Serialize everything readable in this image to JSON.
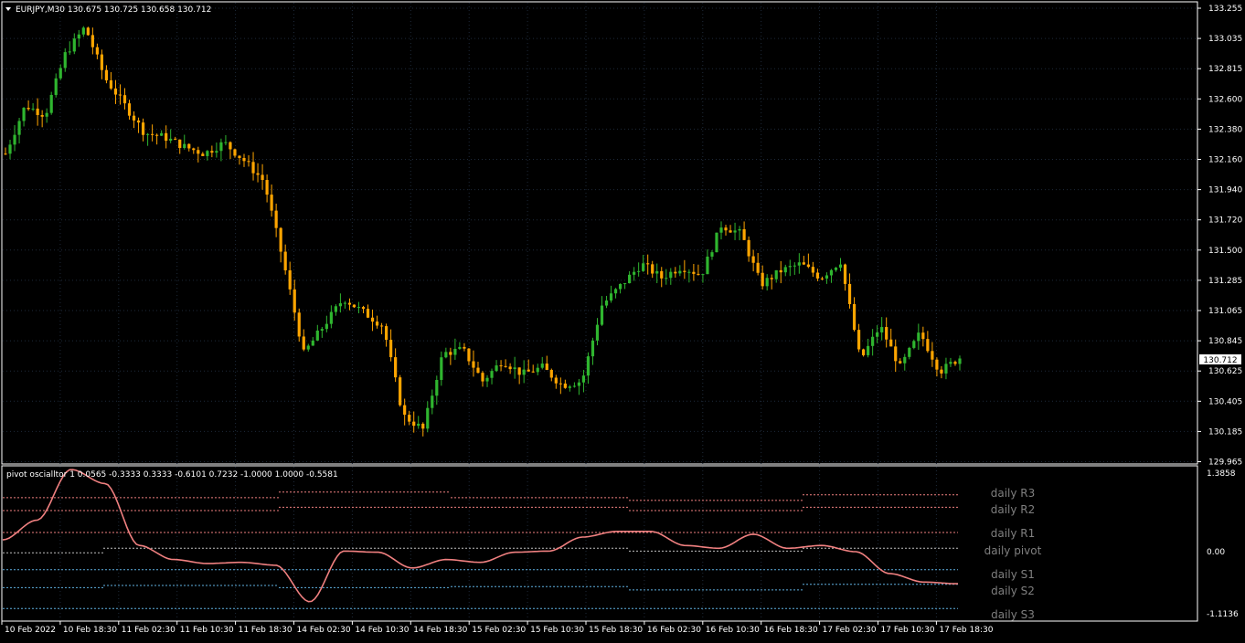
{
  "window": {
    "symbol_header": "EURJPY,M30  130.675 130.725 130.658 130.712",
    "indicator_header": "pivot oscialltor 1 0.0565 -0.3333 0.3333 -0.6101 0.7232 -1.0000 1.0000 -0.5581",
    "current_price_label": "130.712"
  },
  "colors": {
    "background": "#000000",
    "frame": "#ffffff",
    "grid": "#1e2a3a",
    "bull_candle": "#2fb52f",
    "bear_candle": "#ffa500",
    "oscillator_line": "#f08080",
    "resistance_level": "#f08080",
    "support_level": "#5fb0e0",
    "pivot_level": "#c0c0c0",
    "label_text": "#7f7f7f"
  },
  "icons": {
    "menu": "triangle-down-icon"
  },
  "price_axis": {
    "labels": [
      "133.255",
      "133.035",
      "132.815",
      "132.600",
      "132.380",
      "132.160",
      "131.940",
      "131.720",
      "131.500",
      "131.285",
      "131.065",
      "130.845",
      "130.625",
      "130.405",
      "130.185",
      "129.965"
    ]
  },
  "indicator_axis": {
    "labels": [
      "1.3858",
      "0.00",
      "-1.1136"
    ]
  },
  "time_axis": {
    "labels": [
      "10 Feb 2022",
      "10 Feb 18:30",
      "11 Feb 02:30",
      "11 Feb 10:30",
      "11 Feb 18:30",
      "14 Feb 02:30",
      "14 Feb 10:30",
      "14 Feb 18:30",
      "15 Feb 02:30",
      "15 Feb 10:30",
      "15 Feb 18:30",
      "16 Feb 02:30",
      "16 Feb 10:30",
      "16 Feb 18:30",
      "17 Feb 02:30",
      "17 Feb 10:30",
      "17 Feb 18:30"
    ]
  },
  "pivot_labels": {
    "r3": "daily R3",
    "r2": "daily R2",
    "r1": "daily R1",
    "pivot": "daily pivot",
    "s1": "daily S1",
    "s2": "daily S2",
    "s3": "daily S3"
  },
  "chart_data": {
    "type": "candlestick",
    "symbol": "EURJPY",
    "timeframe": "M30",
    "ohlc_last": {
      "open": 130.675,
      "high": 130.725,
      "low": 130.658,
      "close": 130.712
    },
    "price_waypoints": [
      132.2,
      132.55,
      132.48,
      132.92,
      133.12,
      132.75,
      132.55,
      132.35,
      132.32,
      132.25,
      132.2,
      132.28,
      132.15,
      132.0,
      131.4,
      130.75,
      130.95,
      131.15,
      131.05,
      130.95,
      130.3,
      130.2,
      130.75,
      130.78,
      130.55,
      130.7,
      130.6,
      130.65,
      130.52,
      130.55,
      131.1,
      131.25,
      131.4,
      131.3,
      131.38,
      131.32,
      131.68,
      131.62,
      131.25,
      131.35,
      131.4,
      131.3,
      131.42,
      130.7,
      130.95,
      130.65,
      130.9,
      130.62,
      130.72
    ],
    "oscillator_waypoints": [
      0.2,
      0.55,
      1.45,
      1.2,
      0.1,
      -0.15,
      -0.22,
      -0.2,
      -0.25,
      -0.9,
      0.0,
      -0.02,
      -0.3,
      -0.15,
      -0.2,
      -0.02,
      0.0,
      0.25,
      0.35,
      0.35,
      0.1,
      0.05,
      0.3,
      0.05,
      0.1,
      -0.01,
      -0.4,
      -0.55,
      -0.58
    ],
    "oscillator_range": [
      -1.1136,
      1.3858
    ]
  }
}
